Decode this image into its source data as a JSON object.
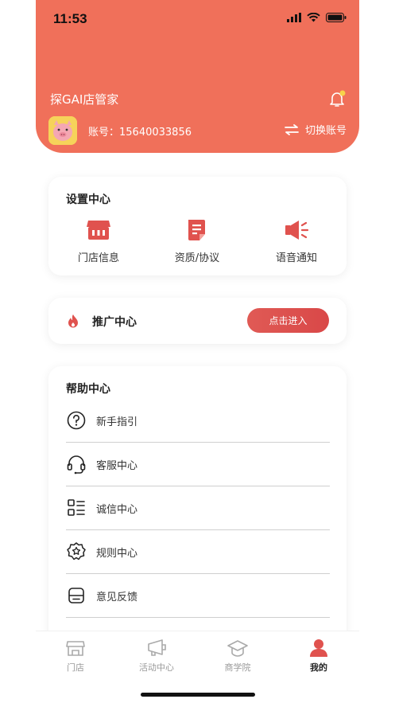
{
  "status_bar": {
    "time": "11:53"
  },
  "header": {
    "app_title": "探GAI店管家",
    "account_label": "账号：15640033856",
    "switch_label": "切换账号",
    "header_color": "#f0705a"
  },
  "settings": {
    "title": "设置中心",
    "items": [
      {
        "label": "门店信息",
        "icon": "store-icon"
      },
      {
        "label": "资质/协议",
        "icon": "document-icon"
      },
      {
        "label": "语音通知",
        "icon": "speaker-icon"
      }
    ]
  },
  "promotion": {
    "title": "推广中心",
    "button_label": "点击进入",
    "icon": "fire-icon"
  },
  "help": {
    "title": "帮助中心",
    "items": [
      {
        "label": "新手指引",
        "icon": "question-icon"
      },
      {
        "label": "客服中心",
        "icon": "headset-icon"
      },
      {
        "label": "诚信中心",
        "icon": "list-icon"
      },
      {
        "label": "规则中心",
        "icon": "badge-icon"
      },
      {
        "label": "意见反馈",
        "icon": "feedback-icon"
      }
    ]
  },
  "tabbar": {
    "tabs": [
      {
        "label": "门店",
        "icon": "shop-tab-icon",
        "active": false
      },
      {
        "label": "活动中心",
        "icon": "activity-tab-icon",
        "active": false
      },
      {
        "label": "商学院",
        "icon": "academy-tab-icon",
        "active": false
      },
      {
        "label": "我的",
        "icon": "profile-tab-icon",
        "active": true
      }
    ]
  },
  "colors": {
    "accent": "#e0524e",
    "header": "#f0705a"
  }
}
